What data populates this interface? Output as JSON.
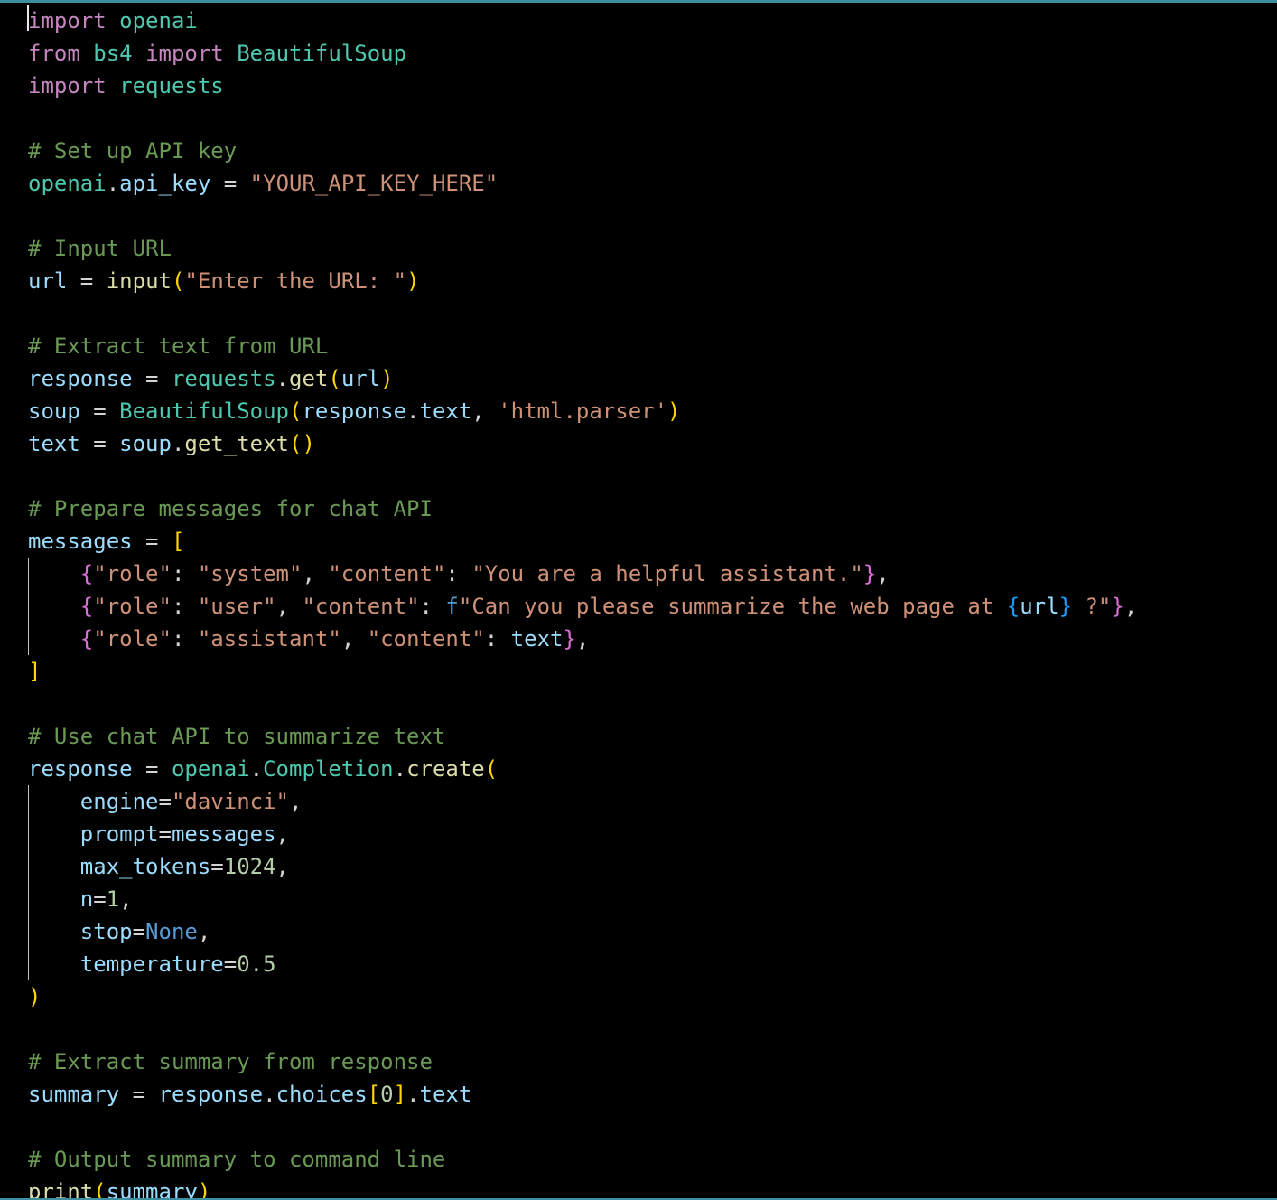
{
  "editor": {
    "language": "python",
    "theme_colors": {
      "background": "#000000",
      "keyword": "#c586c0",
      "module": "#4ec9b0",
      "variable": "#9cdcfe",
      "string": "#ce9178",
      "comment": "#6a9955",
      "function": "#dcdcaa",
      "bracket_level_1": "#ffd700",
      "bracket_level_2": "#da70d6",
      "bracket_level_3": "#179fff",
      "number": "#b5cea8",
      "constant": "#569cd6",
      "current_line_border": "#c9702a"
    },
    "lines": [
      [
        [
          "kw",
          "import"
        ],
        [
          "op",
          " "
        ],
        [
          "mod",
          "openai"
        ]
      ],
      [
        [
          "kw",
          "from"
        ],
        [
          "op",
          " "
        ],
        [
          "mod",
          "bs4"
        ],
        [
          "op",
          " "
        ],
        [
          "kw",
          "import"
        ],
        [
          "op",
          " "
        ],
        [
          "mod",
          "BeautifulSoup"
        ]
      ],
      [
        [
          "kw",
          "import"
        ],
        [
          "op",
          " "
        ],
        [
          "mod",
          "requests"
        ]
      ],
      [],
      [
        [
          "cmt",
          "# Set up API key"
        ]
      ],
      [
        [
          "mod",
          "openai"
        ],
        [
          "op",
          "."
        ],
        [
          "var",
          "api_key"
        ],
        [
          "op",
          " = "
        ],
        [
          "str",
          "\"YOUR_API_KEY_HERE\""
        ]
      ],
      [],
      [
        [
          "cmt",
          "# Input URL"
        ]
      ],
      [
        [
          "var",
          "url"
        ],
        [
          "op",
          " = "
        ],
        [
          "fn",
          "input"
        ],
        [
          "b1",
          "("
        ],
        [
          "str",
          "\"Enter the URL: \""
        ],
        [
          "b1",
          ")"
        ]
      ],
      [],
      [
        [
          "cmt",
          "# Extract text from URL"
        ]
      ],
      [
        [
          "var",
          "response"
        ],
        [
          "op",
          " = "
        ],
        [
          "mod",
          "requests"
        ],
        [
          "op",
          "."
        ],
        [
          "fn",
          "get"
        ],
        [
          "b1",
          "("
        ],
        [
          "var",
          "url"
        ],
        [
          "b1",
          ")"
        ]
      ],
      [
        [
          "var",
          "soup"
        ],
        [
          "op",
          " = "
        ],
        [
          "mod",
          "BeautifulSoup"
        ],
        [
          "b1",
          "("
        ],
        [
          "var",
          "response"
        ],
        [
          "op",
          "."
        ],
        [
          "var",
          "text"
        ],
        [
          "op",
          ", "
        ],
        [
          "str",
          "'html.parser'"
        ],
        [
          "b1",
          ")"
        ]
      ],
      [
        [
          "var",
          "text"
        ],
        [
          "op",
          " = "
        ],
        [
          "var",
          "soup"
        ],
        [
          "op",
          "."
        ],
        [
          "fn",
          "get_text"
        ],
        [
          "b1",
          "()"
        ]
      ],
      [],
      [
        [
          "cmt",
          "# Prepare messages for chat API"
        ]
      ],
      [
        [
          "var",
          "messages"
        ],
        [
          "op",
          " = "
        ],
        [
          "b1",
          "["
        ]
      ],
      [
        [
          "op",
          "    "
        ],
        [
          "b2",
          "{"
        ],
        [
          "str",
          "\"role\""
        ],
        [
          "op",
          ": "
        ],
        [
          "str",
          "\"system\""
        ],
        [
          "op",
          ", "
        ],
        [
          "str",
          "\"content\""
        ],
        [
          "op",
          ": "
        ],
        [
          "str",
          "\"You are a helpful assistant.\""
        ],
        [
          "b2",
          "}"
        ],
        [
          "op",
          ","
        ]
      ],
      [
        [
          "op",
          "    "
        ],
        [
          "b2",
          "{"
        ],
        [
          "str",
          "\"role\""
        ],
        [
          "op",
          ": "
        ],
        [
          "str",
          "\"user\""
        ],
        [
          "op",
          ", "
        ],
        [
          "str",
          "\"content\""
        ],
        [
          "op",
          ": "
        ],
        [
          "cst",
          "f"
        ],
        [
          "str",
          "\"Can you please summarize the web page at "
        ],
        [
          "b3",
          "{"
        ],
        [
          "var",
          "url"
        ],
        [
          "b3",
          "}"
        ],
        [
          "str",
          " ?\""
        ],
        [
          "b2",
          "}"
        ],
        [
          "op",
          ","
        ]
      ],
      [
        [
          "op",
          "    "
        ],
        [
          "b2",
          "{"
        ],
        [
          "str",
          "\"role\""
        ],
        [
          "op",
          ": "
        ],
        [
          "str",
          "\"assistant\""
        ],
        [
          "op",
          ", "
        ],
        [
          "str",
          "\"content\""
        ],
        [
          "op",
          ": "
        ],
        [
          "var",
          "text"
        ],
        [
          "b2",
          "}"
        ],
        [
          "op",
          ","
        ]
      ],
      [
        [
          "b1",
          "]"
        ]
      ],
      [],
      [
        [
          "cmt",
          "# Use chat API to summarize text"
        ]
      ],
      [
        [
          "var",
          "response"
        ],
        [
          "op",
          " = "
        ],
        [
          "mod",
          "openai"
        ],
        [
          "op",
          "."
        ],
        [
          "mod",
          "Completion"
        ],
        [
          "op",
          "."
        ],
        [
          "fn",
          "create"
        ],
        [
          "b1",
          "("
        ]
      ],
      [
        [
          "op",
          "    "
        ],
        [
          "var",
          "engine"
        ],
        [
          "op",
          "="
        ],
        [
          "str",
          "\"davinci\""
        ],
        [
          "op",
          ","
        ]
      ],
      [
        [
          "op",
          "    "
        ],
        [
          "var",
          "prompt"
        ],
        [
          "op",
          "="
        ],
        [
          "var",
          "messages"
        ],
        [
          "op",
          ","
        ]
      ],
      [
        [
          "op",
          "    "
        ],
        [
          "var",
          "max_tokens"
        ],
        [
          "op",
          "="
        ],
        [
          "num",
          "1024"
        ],
        [
          "op",
          ","
        ]
      ],
      [
        [
          "op",
          "    "
        ],
        [
          "var",
          "n"
        ],
        [
          "op",
          "="
        ],
        [
          "num",
          "1"
        ],
        [
          "op",
          ","
        ]
      ],
      [
        [
          "op",
          "    "
        ],
        [
          "var",
          "stop"
        ],
        [
          "op",
          "="
        ],
        [
          "cst",
          "None"
        ],
        [
          "op",
          ","
        ]
      ],
      [
        [
          "op",
          "    "
        ],
        [
          "var",
          "temperature"
        ],
        [
          "op",
          "="
        ],
        [
          "num",
          "0.5"
        ]
      ],
      [
        [
          "b1",
          ")"
        ]
      ],
      [],
      [
        [
          "cmt",
          "# Extract summary from response"
        ]
      ],
      [
        [
          "var",
          "summary"
        ],
        [
          "op",
          " = "
        ],
        [
          "var",
          "response"
        ],
        [
          "op",
          "."
        ],
        [
          "var",
          "choices"
        ],
        [
          "b1",
          "["
        ],
        [
          "num",
          "0"
        ],
        [
          "b1",
          "]"
        ],
        [
          "op",
          "."
        ],
        [
          "var",
          "text"
        ]
      ],
      [],
      [
        [
          "cmt",
          "# Output summary to command line"
        ]
      ],
      [
        [
          "fn",
          "print"
        ],
        [
          "b1",
          "("
        ],
        [
          "var",
          "summary"
        ],
        [
          "b1",
          ")"
        ]
      ]
    ]
  }
}
